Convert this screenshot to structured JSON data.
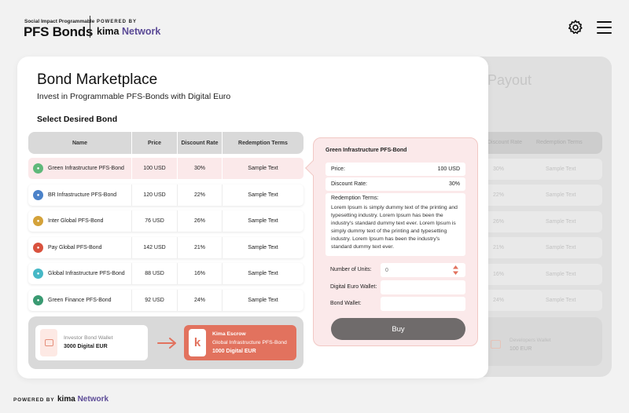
{
  "header": {
    "logo_small": "Social Impact Programmable",
    "logo_big": "PFS Bonds",
    "powered_by": "POWERED BY",
    "kima_prefix": "kima",
    "kima_suffix": "Network",
    "settings_icon": "gear-icon",
    "menu_icon": "hamburger-menu-icon"
  },
  "page": {
    "title": "Bond Marketplace",
    "subtitle": "Invest in Programmable PFS-Bonds with Digital Euro",
    "section_label": "Select Desired Bond"
  },
  "table": {
    "headers": [
      "Name",
      "Price",
      "Discount Rate",
      "Redemption Terms"
    ],
    "rows": [
      {
        "name": "Green Infrastructure PFS-Bond",
        "price": "100 USD",
        "discount": "30%",
        "terms": "Sample Text",
        "icon_color": "#5fb87a",
        "selected": true
      },
      {
        "name": "BR Infrastructure PFS-Bond",
        "price": "120 USD",
        "discount": "22%",
        "terms": "Sample Text",
        "icon_color": "#4b82c9"
      },
      {
        "name": "Inter Global PFS-Bond",
        "price": "76 USD",
        "discount": "26%",
        "terms": "Sample Text",
        "icon_color": "#d4a23a"
      },
      {
        "name": "Pay Global PFS-Bond",
        "price": "142 USD",
        "discount": "21%",
        "terms": "Sample Text",
        "icon_color": "#d9523e"
      },
      {
        "name": "Global Infrastructure PFS-Bond",
        "price": "88 USD",
        "discount": "16%",
        "terms": "Sample Text",
        "icon_color": "#46b8c6"
      },
      {
        "name": "Green Finance PFS-Bond",
        "price": "92 USD",
        "discount": "24%",
        "terms": "Sample Text",
        "icon_color": "#3a9a72"
      }
    ]
  },
  "wallets": {
    "investor_label": "Investor Bond Wallet",
    "investor_value": "3000 Digital EUR",
    "escrow_label": "Kima Escrow",
    "escrow_bond": "Global Infrastructure PFS-Bond",
    "escrow_value": "1000 Digital EUR",
    "escrow_letter": "k"
  },
  "panel": {
    "title": "Green Infrastructure PFS-Bond",
    "price_label": "Price:",
    "price_value": "100 USD",
    "discount_label": "Discount Rate:",
    "discount_value": "30%",
    "redemption_label": "Redemption Terms:",
    "redemption_text": "Lorem Ipsum is simply dummy text of the printing and typesetting industry. Lorem Ipsum has been the industry's standard dummy text ever. Lorem Ipsum is simply dummy text of the printing and typesetting industry. Lorem Ipsum has been the industry's standard dummy text ever.",
    "units_label": "Number of Units:",
    "units_placeholder": "0",
    "euro_wallet_label": "Digital Euro Wallet:",
    "bond_wallet_label": "Bond Wallet:",
    "buy_label": "Buy"
  },
  "background": {
    "title": "Payout",
    "headers": [
      "Discount Rate",
      "Redemption Terms"
    ],
    "rows": [
      {
        "discount": "30%",
        "terms": "Sample Text"
      },
      {
        "discount": "22%",
        "terms": "Sample Text"
      },
      {
        "discount": "26%",
        "terms": "Sample Text"
      },
      {
        "discount": "21%",
        "terms": "Sample Text"
      },
      {
        "discount": "16%",
        "terms": "Sample Text"
      },
      {
        "discount": "24%",
        "terms": "Sample Text"
      }
    ],
    "wallet_label": "Developers Wallet",
    "wallet_value": "100 EUR"
  },
  "footer": {
    "powered_by": "POWERED BY",
    "kima_prefix": "kima",
    "kima_suffix": "Network"
  },
  "colors": {
    "accent": "#e2725e",
    "selected_row": "#fbe9ea",
    "buy_button": "#6f6b6b"
  }
}
